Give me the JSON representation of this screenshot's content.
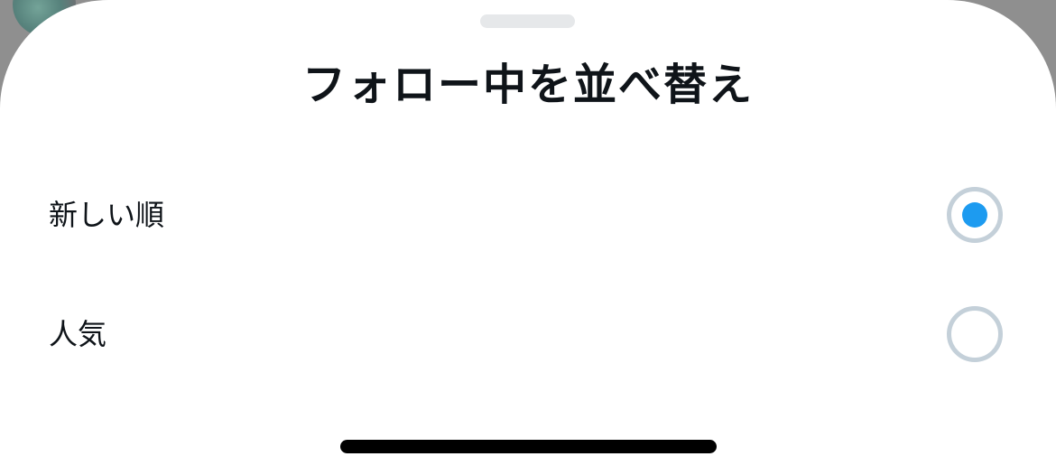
{
  "sheet": {
    "title": "フォロー中を並べ替え",
    "options": [
      {
        "label": "新しい順",
        "selected": true
      },
      {
        "label": "人気",
        "selected": false
      }
    ]
  },
  "colors": {
    "accent": "#1d9bf0",
    "text": "#0f1419",
    "radio_border": "#c4d0d9",
    "grabber": "#e6e8ea"
  }
}
